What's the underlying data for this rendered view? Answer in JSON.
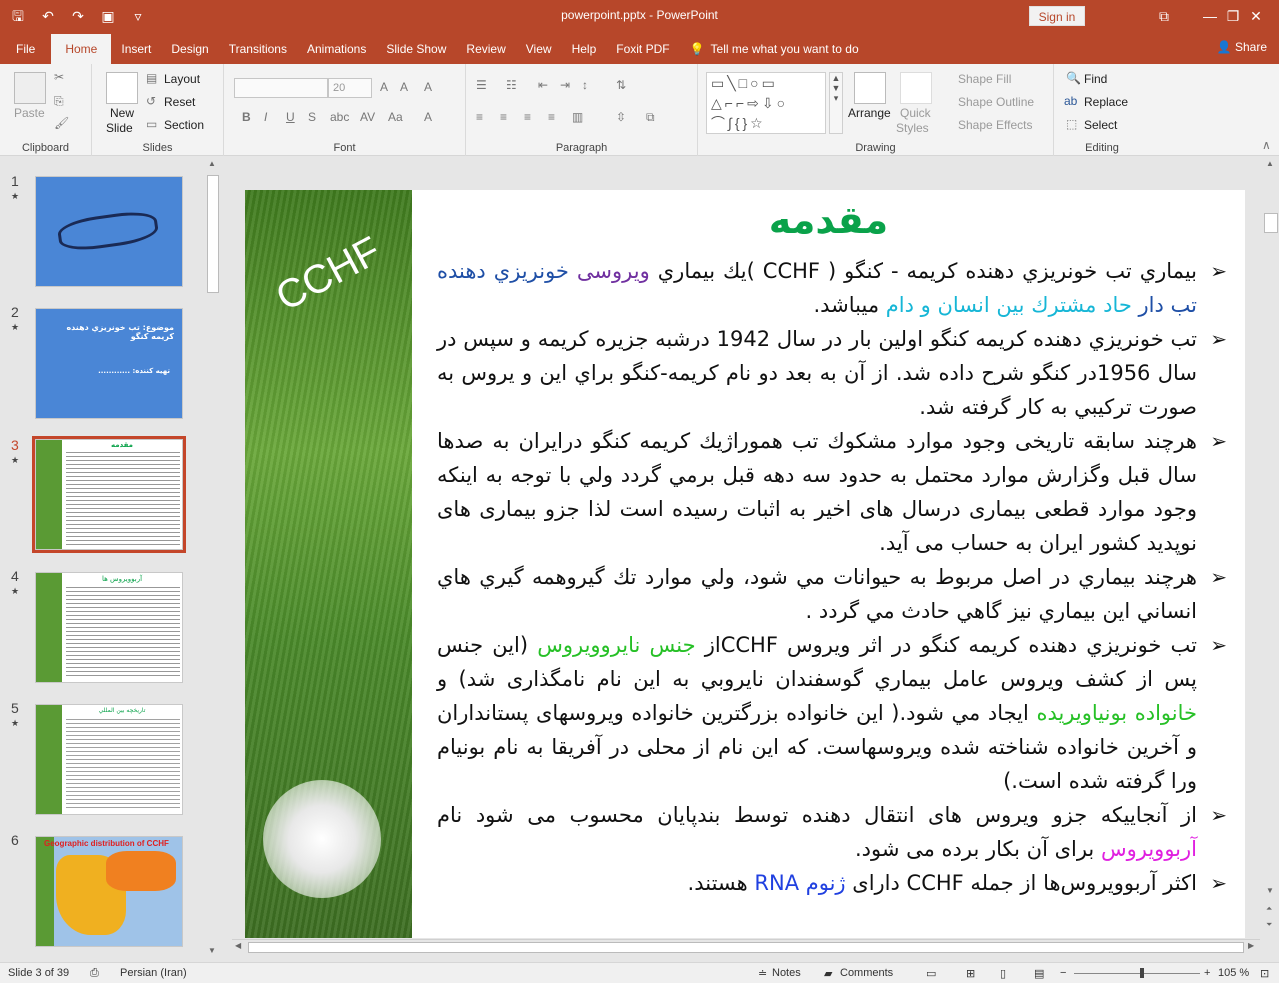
{
  "app": {
    "doc_title": "powerpoint.pptx  -  PowerPoint",
    "signin": "Sign in"
  },
  "tabs": [
    "File",
    "Home",
    "Insert",
    "Design",
    "Transitions",
    "Animations",
    "Slide Show",
    "Review",
    "View",
    "Help",
    "Foxit PDF"
  ],
  "tellme": "Tell me what you want to do",
  "share": "Share",
  "ribbon": {
    "clipboard": {
      "paste": "Paste",
      "label": "Clipboard"
    },
    "slides": {
      "new_slide_1": "New",
      "new_slide_2": "Slide",
      "layout": "Layout",
      "reset": "Reset",
      "section": "Section",
      "label": "Slides"
    },
    "font": {
      "size": "20",
      "label": "Font"
    },
    "paragraph": {
      "label": "Paragraph"
    },
    "drawing": {
      "arrange": "Arrange",
      "quick_styles_1": "Quick",
      "quick_styles_2": "Styles",
      "shape_fill": "Shape Fill",
      "shape_outline": "Shape Outline",
      "shape_effects": "Shape Effects",
      "label": "Drawing"
    },
    "editing": {
      "find": "Find",
      "replace": "Replace",
      "select": "Select",
      "label": "Editing"
    }
  },
  "thumbnails": [
    {
      "num": "1",
      "star": "★"
    },
    {
      "num": "2",
      "star": "★",
      "title": "موضوع: تب خونريزي دهنده کريمه کنگو",
      "sub": "تهيه کننده: ............"
    },
    {
      "num": "3",
      "star": "★",
      "title": "مقدمه"
    },
    {
      "num": "4",
      "star": "★",
      "title": "آربوويروس ها"
    },
    {
      "num": "5",
      "star": "★",
      "title": "تاريخچه بين المللي"
    },
    {
      "num": "6",
      "title": "Geographic distribution of CCHF"
    }
  ],
  "slide": {
    "title": "مقدمه",
    "logo_text": "CCHF",
    "bullets": [
      {
        "parts": [
          {
            "t": "بيماري تب خونريزي دهنده کريمه - کنگو ( CCHF )يك بيماري ",
            "c": ""
          },
          {
            "t": "ويروسی",
            "c": "c-purple"
          },
          {
            "t": " ",
            "c": ""
          },
          {
            "t": "خونريزي دهنده",
            "c": "c-blue"
          },
          {
            "t": " ",
            "c": ""
          },
          {
            "t": "تب دار",
            "c": "c-blue"
          },
          {
            "t": " ",
            "c": ""
          },
          {
            "t": "حاد",
            "c": "c-cyan"
          },
          {
            "t": " ",
            "c": ""
          },
          {
            "t": "مشترك بين انسان و دام",
            "c": "c-cyan"
          },
          {
            "t": " ميباشد.",
            "c": ""
          }
        ]
      },
      {
        "parts": [
          {
            "t": "تب خونريزي دهنده کريمه کنگو اولين بار در سال 1942 درشبه جزيره کريمه و سپس در سال 1956در كنگو شرح داده شد. از آن به بعد دو نام كريمه-كنگو براي  اين و يروس به صورت تركيبي به كار گرفته شد.",
            "c": ""
          }
        ]
      },
      {
        "parts": [
          {
            "t": "هرچند سابقه تاريخی وجود موارد مشکوك تب هموراژيك كريمه كنگو درايران به صدها سال قبل وگزارش موارد محتمل به حدود سه دهه قبل برمي گردد ولي با توجه به اينكه وجود موارد قطعی بيماری درسال های اخير به اثبات رسيده است لذا جزو بيماری های نوپديد كشور ايران به حساب می آيد.",
            "c": ""
          }
        ]
      },
      {
        "parts": [
          {
            "t": "هرچند بيماري در اصل مربوط به حيوانات مي شود، ولي موارد تك گيروهمه گيري هاي انساني اين بيماري نيز گاهي حادث مي گردد .",
            "c": ""
          }
        ]
      },
      {
        "parts": [
          {
            "t": " تب خونريزي دهنده كريمه كنگو در اثر ويروس CCHFاز ",
            "c": ""
          },
          {
            "t": "جنس نايروويروس",
            "c": "c-green"
          },
          {
            "t": " (اين جنس پس از كشف ويروس عامل بيماري گوسفندان نايروبي به اين نام نامگذاری شد) و ",
            "c": ""
          },
          {
            "t": "خانواده بونياويريده",
            "c": "c-green"
          },
          {
            "t": " ايجاد مي شود.( اين خانواده بزرگترين خانواده ويروسهای پستانداران و آخرين خانواده شناخته شده ويروسهاست. که اين نام از محلی در آفريقا به نام بونيام ورا گرفته شده است.)",
            "c": ""
          }
        ]
      },
      {
        "parts": [
          {
            "t": "از آنجاييكه جزو ويروس های انتقال دهنده توسط بندپايان محسوب می شود نام ",
            "c": ""
          },
          {
            "t": "آربوويروس",
            "c": "c-magenta"
          },
          {
            "t": " برای آن بكار برده می شود.",
            "c": ""
          }
        ]
      },
      {
        "parts": [
          {
            "t": "اکثر آربوويروس‌ها از جمله CCHF دارای ",
            "c": ""
          },
          {
            "t": "ژنوم RNA",
            "c": "c-bright"
          },
          {
            "t": " هستند.",
            "c": ""
          }
        ]
      }
    ]
  },
  "status": {
    "slide_info": "Slide 3 of 39",
    "language": "Persian (Iran)",
    "notes": "Notes",
    "comments": "Comments",
    "zoom": "105 %"
  }
}
